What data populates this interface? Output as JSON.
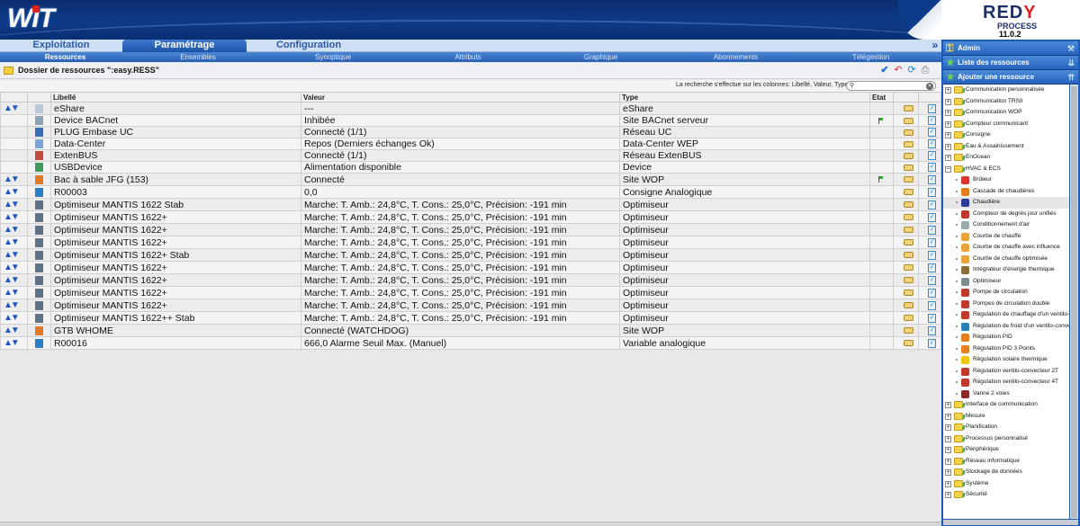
{
  "header": {
    "logo_text": "WIT",
    "brand_main": "RED",
    "brand_y": "Y",
    "brand_sub": "PROCESS",
    "version": "11.0.2"
  },
  "main_tabs": [
    "Exploitation",
    "Paramétrage",
    "Configuration"
  ],
  "active_main_tab": "Paramétrage",
  "sub_tabs": [
    "Ressources",
    "Ensembles",
    "Synoptique",
    "Attributs",
    "Graphique",
    "Abonnements",
    "Télégestion"
  ],
  "active_sub_tab": "Ressources",
  "folder": {
    "title": "Dossier de ressources \":easy.RESS\""
  },
  "search": {
    "label": "La recherche s'effectue sur les colonnes: Libellé, Valeur, Type",
    "value": ""
  },
  "table": {
    "columns": [
      "Libellé",
      "Valeur",
      "Type",
      "Etat"
    ],
    "rows": [
      {
        "sort": true,
        "icon": "eshare-icon",
        "label": "eShare",
        "value": "---",
        "type": "eShare",
        "etat": false
      },
      {
        "sort": false,
        "icon": "bacnet-device-icon",
        "label": "Device BACnet",
        "value": "Inhibée",
        "type": "Site BACnet serveur",
        "etat": true
      },
      {
        "sort": false,
        "icon": "plug-icon",
        "label": "PLUG Embase UC",
        "value": "Connecté (1/1)",
        "type": "Réseau UC",
        "etat": false
      },
      {
        "sort": false,
        "icon": "datacenter-icon",
        "label": "Data-Center",
        "value": "Repos (Derniers échanges Ok)",
        "type": "Data-Center WEP",
        "etat": false
      },
      {
        "sort": false,
        "icon": "extenbus-icon",
        "label": "ExtenBUS",
        "value": "Connecté (1/1)",
        "type": "Réseau ExtenBUS",
        "etat": false
      },
      {
        "sort": false,
        "icon": "usb-icon",
        "label": "USBDevice",
        "value": "Alimentation disponible",
        "type": "Device",
        "etat": false
      },
      {
        "sort": true,
        "icon": "site-wop-icon",
        "label": "Bac à sable JFG (153)",
        "value": "Connecté",
        "type": "Site WOP",
        "etat": true
      },
      {
        "sort": true,
        "icon": "analog-setpoint-icon",
        "label": "R00003",
        "value": "0,0",
        "type": "Consigne Analogique",
        "etat": false
      },
      {
        "sort": true,
        "icon": "optimiser-icon",
        "label": "Optimiseur MANTIS 1622 Stab",
        "value": "Marche: T. Amb.: 24,8°C, T. Cons.: 25,0°C, Précision: -191 min",
        "type": "Optimiseur",
        "etat": false
      },
      {
        "sort": true,
        "icon": "optimiser-icon",
        "label": "Optimiseur MANTIS 1622+",
        "value": "Marche: T. Amb.: 24,8°C, T. Cons.: 25,0°C, Précision: -191 min",
        "type": "Optimiseur",
        "etat": false
      },
      {
        "sort": true,
        "icon": "optimiser-icon",
        "label": "Optimiseur MANTIS 1622+",
        "value": "Marche: T. Amb.: 24,8°C, T. Cons.: 25,0°C, Précision: -191 min",
        "type": "Optimiseur",
        "etat": false
      },
      {
        "sort": true,
        "icon": "optimiser-icon",
        "label": "Optimiseur MANTIS 1622+",
        "value": "Marche: T. Amb.: 24,8°C, T. Cons.: 25,0°C, Précision: -191 min",
        "type": "Optimiseur",
        "etat": false
      },
      {
        "sort": true,
        "icon": "optimiser-icon",
        "label": "Optimiseur MANTIS 1622+ Stab",
        "value": "Marche: T. Amb.: 24,8°C, T. Cons.: 25,0°C, Précision: -191 min",
        "type": "Optimiseur",
        "etat": false
      },
      {
        "sort": true,
        "icon": "optimiser-icon",
        "label": "Optimiseur MANTIS 1622+",
        "value": "Marche: T. Amb.: 24,8°C, T. Cons.: 25,0°C, Précision: -191 min",
        "type": "Optimiseur",
        "etat": false
      },
      {
        "sort": true,
        "icon": "optimiser-icon",
        "label": "Optimiseur MANTIS 1622+",
        "value": "Marche: T. Amb.: 24,8°C, T. Cons.: 25,0°C, Précision: -191 min",
        "type": "Optimiseur",
        "etat": false
      },
      {
        "sort": true,
        "icon": "optimiser-icon",
        "label": "Optimiseur MANTIS 1622+",
        "value": "Marche: T. Amb.: 24,8°C, T. Cons.: 25,0°C, Précision: -191 min",
        "type": "Optimiseur",
        "etat": false
      },
      {
        "sort": true,
        "icon": "optimiser-icon",
        "label": "Optimiseur MANTIS 1622+",
        "value": "Marche: T. Amb.: 24,8°C, T. Cons.: 25,0°C, Précision: -191 min",
        "type": "Optimiseur",
        "etat": false
      },
      {
        "sort": true,
        "icon": "optimiser-icon",
        "label": "Optimiseur MANTIS 1622++ Stab",
        "value": "Marche: T. Amb.: 24,8°C, T. Cons.: 25,0°C, Précision: -191 min",
        "type": "Optimiseur",
        "etat": false
      },
      {
        "sort": true,
        "icon": "site-wop-icon",
        "label": "GTB WHOME",
        "value": "Connecté (WATCHDOG)",
        "type": "Site WOP",
        "etat": false
      },
      {
        "sort": true,
        "icon": "analog-variable-icon",
        "label": "R00016",
        "value": "666,0 Alarme Seuil Max. (Manuel)",
        "type": "Variable analogique",
        "etat": false
      }
    ]
  },
  "right_panel": {
    "admin_label": "Admin",
    "list_label": "Liste des ressources",
    "add_label": "Ajouter une ressource",
    "tree": [
      {
        "level": 0,
        "label": "Communication personnalisée",
        "expanded": false
      },
      {
        "level": 0,
        "label": "Communication TRSII",
        "expanded": false
      },
      {
        "level": 0,
        "label": "Communication WOP",
        "expanded": false
      },
      {
        "level": 0,
        "label": "Compteur communicant",
        "expanded": false
      },
      {
        "level": 0,
        "label": "Consigne",
        "expanded": false
      },
      {
        "level": 0,
        "label": "Eau & Assainissement",
        "expanded": false
      },
      {
        "level": 0,
        "label": "EnOcean",
        "expanded": false
      },
      {
        "level": 0,
        "label": "HVAC & ECS",
        "expanded": true
      },
      {
        "level": 1,
        "label": "Brûleur",
        "color": "#d33"
      },
      {
        "level": 1,
        "label": "Cascade de chaudières",
        "color": "#e67e22"
      },
      {
        "level": 1,
        "label": "Chaudière",
        "color": "#2c3e99",
        "selected": true
      },
      {
        "level": 1,
        "label": "Compteur de degrés jour unifiés",
        "color": "#c0392b"
      },
      {
        "level": 1,
        "label": "Conditionnement d'air",
        "color": "#9aa"
      },
      {
        "level": 1,
        "label": "Courbe de chauffe",
        "color": "#e8a33d"
      },
      {
        "level": 1,
        "label": "Courbe de chauffe avec influence",
        "color": "#e8a33d"
      },
      {
        "level": 1,
        "label": "Courbe de chauffe optimisée",
        "color": "#e8a33d"
      },
      {
        "level": 1,
        "label": "Intégrateur d'énergie thermique",
        "color": "#8a6d3b"
      },
      {
        "level": 1,
        "label": "Optimiseur",
        "color": "#7f8c8d"
      },
      {
        "level": 1,
        "label": "Pompe de circulation",
        "color": "#c0392b"
      },
      {
        "level": 1,
        "label": "Pompes de circulation double",
        "color": "#c0392b"
      },
      {
        "level": 1,
        "label": "Régulation de chauffage d'un ventilo-co...",
        "color": "#c0392b"
      },
      {
        "level": 1,
        "label": "Régulation de froid d'un ventilo-convect...",
        "color": "#2980b9"
      },
      {
        "level": 1,
        "label": "Régulation PID",
        "color": "#e67e22"
      },
      {
        "level": 1,
        "label": "Régulation PID 3 Points",
        "color": "#e67e22"
      },
      {
        "level": 1,
        "label": "Régulation solaire thermique",
        "color": "#f1c40f"
      },
      {
        "level": 1,
        "label": "Régulation ventilo-convecteur 2T",
        "color": "#c0392b"
      },
      {
        "level": 1,
        "label": "Régulation ventilo-convecteur 4T",
        "color": "#c0392b"
      },
      {
        "level": 1,
        "label": "Vanne 2 voies",
        "color": "#8e2a2a"
      },
      {
        "level": 0,
        "label": "Interface de communication",
        "expanded": false
      },
      {
        "level": 0,
        "label": "Mesure",
        "expanded": false
      },
      {
        "level": 0,
        "label": "Planification",
        "expanded": false
      },
      {
        "level": 0,
        "label": "Processus personnalisé",
        "expanded": false
      },
      {
        "level": 0,
        "label": "Périphérique",
        "expanded": false
      },
      {
        "level": 0,
        "label": "Réseau informatique",
        "expanded": false
      },
      {
        "level": 0,
        "label": "Stockage de données",
        "expanded": false
      },
      {
        "level": 0,
        "label": "Système",
        "expanded": false
      },
      {
        "level": 0,
        "label": "Sécurité",
        "expanded": false
      }
    ]
  }
}
